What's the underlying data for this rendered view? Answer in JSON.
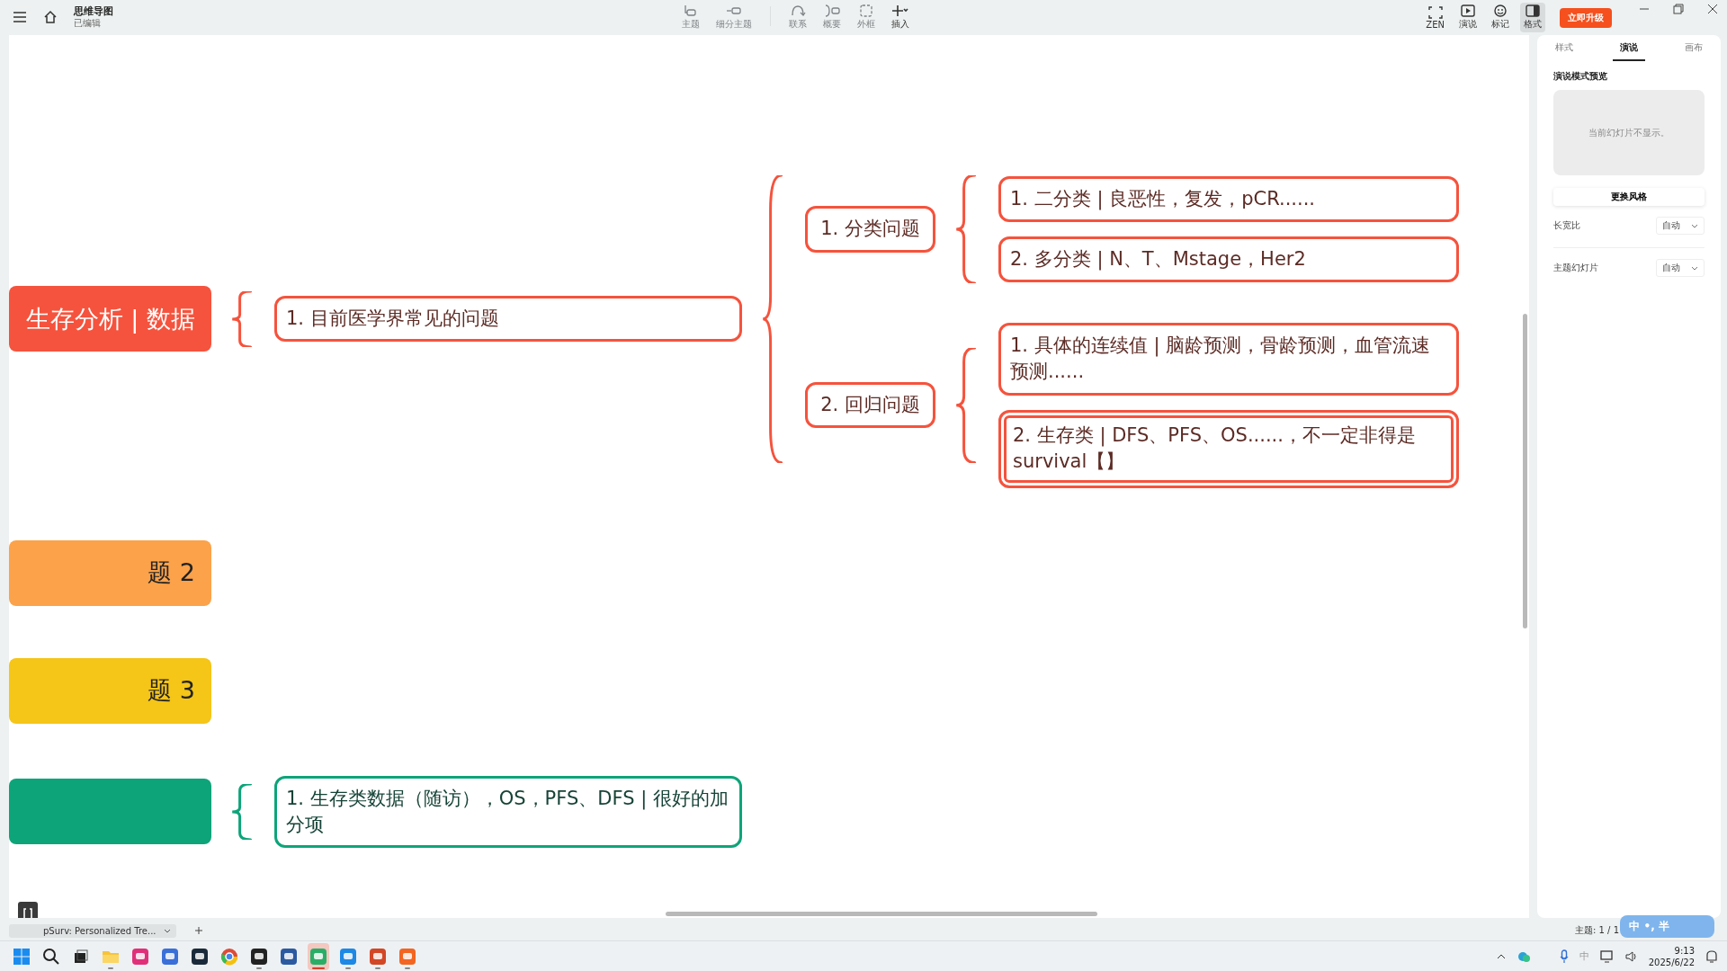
{
  "app": {
    "title": "思维导图",
    "subtitle": "已编辑"
  },
  "toolbar": [
    {
      "kind": "topic",
      "label": "主题",
      "disabled": true
    },
    {
      "kind": "subtopic",
      "label": "细分主题",
      "disabled": true
    },
    {
      "kind": "relation",
      "label": "联系",
      "disabled": true
    },
    {
      "kind": "summary",
      "label": "概要",
      "disabled": true
    },
    {
      "kind": "boundary",
      "label": "外框",
      "disabled": true
    },
    {
      "kind": "insert",
      "label": "插入",
      "disabled": false
    }
  ],
  "view_tools": [
    {
      "kind": "zen",
      "label": "ZEN",
      "selected": false
    },
    {
      "kind": "present",
      "label": "演说",
      "selected": false
    },
    {
      "kind": "mark",
      "label": "标记",
      "selected": false
    },
    {
      "kind": "format",
      "label": "格式",
      "selected": true
    }
  ],
  "upgrade_button": "立即升级",
  "mindmap": [
    {
      "text": "生存分析 | 数据",
      "color": "#f5533d",
      "selected": false,
      "children": [
        {
          "text": "1. 目前医学界常见的问题",
          "selected": false,
          "children": [
            {
              "text": "1. 分类问题",
              "selected": false,
              "children": [
                {
                  "text": "1. 二分类 | 良恶性，复发，pCR......",
                  "selected": false
                },
                {
                  "text": "2. 多分类 | N、T、Mstage，Her2",
                  "selected": false
                }
              ]
            },
            {
              "text": "2. 回归问题",
              "selected": false,
              "children": [
                {
                  "text": "1. 具体的连续值 | 脑龄预测，骨龄预测，血管流速预测......",
                  "selected": false
                },
                {
                  "text": "2. 生存类 | DFS、PFS、OS......，不一定非得是survival【】",
                  "selected": true
                }
              ]
            }
          ]
        }
      ]
    },
    {
      "text": "题 2",
      "color": "#fba24a",
      "selected": false
    },
    {
      "text": "题 3",
      "color": "#f5c518",
      "selected": false
    },
    {
      "color": "#0ea47a",
      "selected": false,
      "children": [
        {
          "text": "1. 生存类数据（随访），OS，PFS、DFS | 很好的加分项",
          "selected": false
        }
      ]
    }
  ],
  "panel": {
    "tabs": [
      {
        "label": "样式",
        "selected": false
      },
      {
        "label": "演说",
        "selected": true
      },
      {
        "label": "画布",
        "selected": false
      }
    ],
    "heading": "演说模式预览",
    "preview_text": "当前幻灯片不显示。",
    "style_button": "更换风格",
    "settings": [
      {
        "label": "长宽比",
        "value": "自动"
      },
      {
        "label": "主题幻灯片",
        "value": "自动"
      }
    ]
  },
  "sheet_tab": "pSurv: Personalized Tre...",
  "status": "主题: 1 / 1",
  "ime_widget": "中 •, 半",
  "taskbar": [
    {
      "kind": "start",
      "running": false,
      "selected": false
    },
    {
      "kind": "search",
      "running": false,
      "selected": false
    },
    {
      "kind": "taskview",
      "running": false,
      "selected": false
    },
    {
      "kind": "folder",
      "running": true,
      "selected": false
    },
    {
      "kind": "app",
      "color": "#e0307a",
      "running": false,
      "selected": false
    },
    {
      "kind": "app",
      "color": "#3a6fd8",
      "running": false,
      "selected": false
    },
    {
      "kind": "app",
      "color": "#1b2a3a",
      "running": false,
      "selected": false
    },
    {
      "kind": "browser",
      "running": false,
      "selected": false
    },
    {
      "kind": "app",
      "color": "#222222",
      "running": true,
      "selected": false
    },
    {
      "kind": "app",
      "color": "#2c5aa0",
      "running": false,
      "selected": false
    },
    {
      "kind": "app",
      "color": "#2aae67",
      "running": true,
      "selected": true
    },
    {
      "kind": "app",
      "color": "#1e88e5",
      "running": true,
      "selected": false
    },
    {
      "kind": "app",
      "color": "#d24726",
      "running": true,
      "selected": false
    },
    {
      "kind": "app",
      "color": "#f26522",
      "running": true,
      "selected": false
    }
  ],
  "tray": {
    "ime": "中",
    "time": "9:13",
    "date": "2025/6/22"
  }
}
